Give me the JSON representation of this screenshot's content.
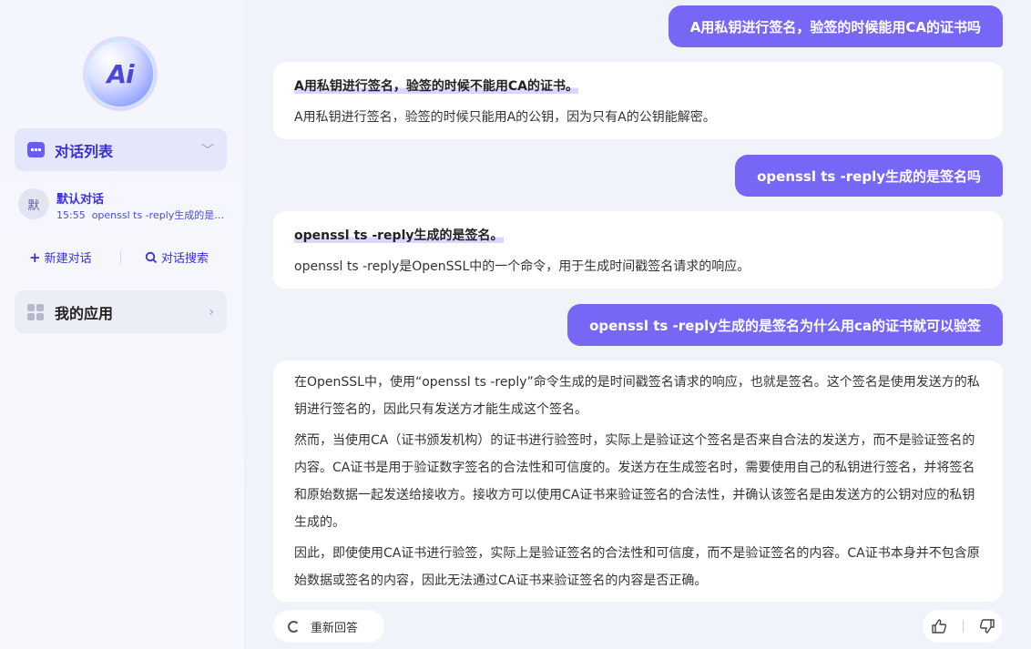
{
  "sidebar": {
    "logo_text": "Ai",
    "conversation_list_label": "对话列表",
    "conversation": {
      "avatar": "默",
      "title": "默认对话",
      "time": "15:55",
      "preview": "openssl ts -reply生成的是签名为什么用ca的证书就可以验签"
    },
    "new_chat_label": "新建对话",
    "search_label": "对话搜索",
    "my_apps_label": "我的应用"
  },
  "messages": [
    {
      "role": "user",
      "text": "A用私钥进行签名，验签的时候能用CA的证书吗"
    },
    {
      "role": "assistant",
      "paragraphs": [
        {
          "strong": true,
          "text": "A用私钥进行签名，验签的时候不能用CA的证书。"
        },
        {
          "strong": false,
          "text": "A用私钥进行签名，验签的时候只能用A的公钥，因为只有A的公钥能解密。"
        }
      ]
    },
    {
      "role": "user",
      "text": "openssl ts -reply生成的是签名吗"
    },
    {
      "role": "assistant",
      "paragraphs": [
        {
          "strong": true,
          "text": "openssl ts -reply生成的是签名。"
        },
        {
          "strong": false,
          "text": "openssl ts -reply是OpenSSL中的一个命令，用于生成时间戳签名请求的响应。"
        }
      ]
    },
    {
      "role": "user",
      "text": "openssl ts -reply生成的是签名为什么用ca的证书就可以验签"
    },
    {
      "role": "assistant",
      "paragraphs": [
        {
          "strong": false,
          "text": "在OpenSSL中，使用“openssl ts -reply”命令生成的是时间戳签名请求的响应，也就是签名。这个签名是使用发送方的私钥进行签名的，因此只有发送方才能生成这个签名。"
        },
        {
          "strong": false,
          "text": "然而，当使用CA（证书颁发机构）的证书进行验签时，实际上是验证这个签名是否来自合法的发送方，而不是验证签名的内容。CA证书是用于验证数字签名的合法性和可信度的。发送方在生成签名时，需要使用自己的私钥进行签名，并将签名和原始数据一起发送给接收方。接收方可以使用CA证书来验证签名的合法性，并确认该签名是由发送方的公钥对应的私钥生成的。"
        },
        {
          "strong": false,
          "text": "因此，即使使用CA证书进行验签，实际上是验证签名的合法性和可信度，而不是验证签名的内容。CA证书本身并不包含原始数据或签名的内容，因此无法通过CA证书来验证签名的内容是否正确。"
        }
      ]
    }
  ],
  "regenerate_label": "重新回答",
  "icons": [
    "chat-icon",
    "chevron-down-icon",
    "plus-icon",
    "search-icon",
    "grid-icon",
    "chevron-right-icon",
    "refresh-icon",
    "thumbs-up-icon",
    "thumbs-down-icon"
  ],
  "colors": {
    "accent": "#7767f7",
    "sidebar_active": "#e4e6fb",
    "link": "#3a2fd0"
  }
}
